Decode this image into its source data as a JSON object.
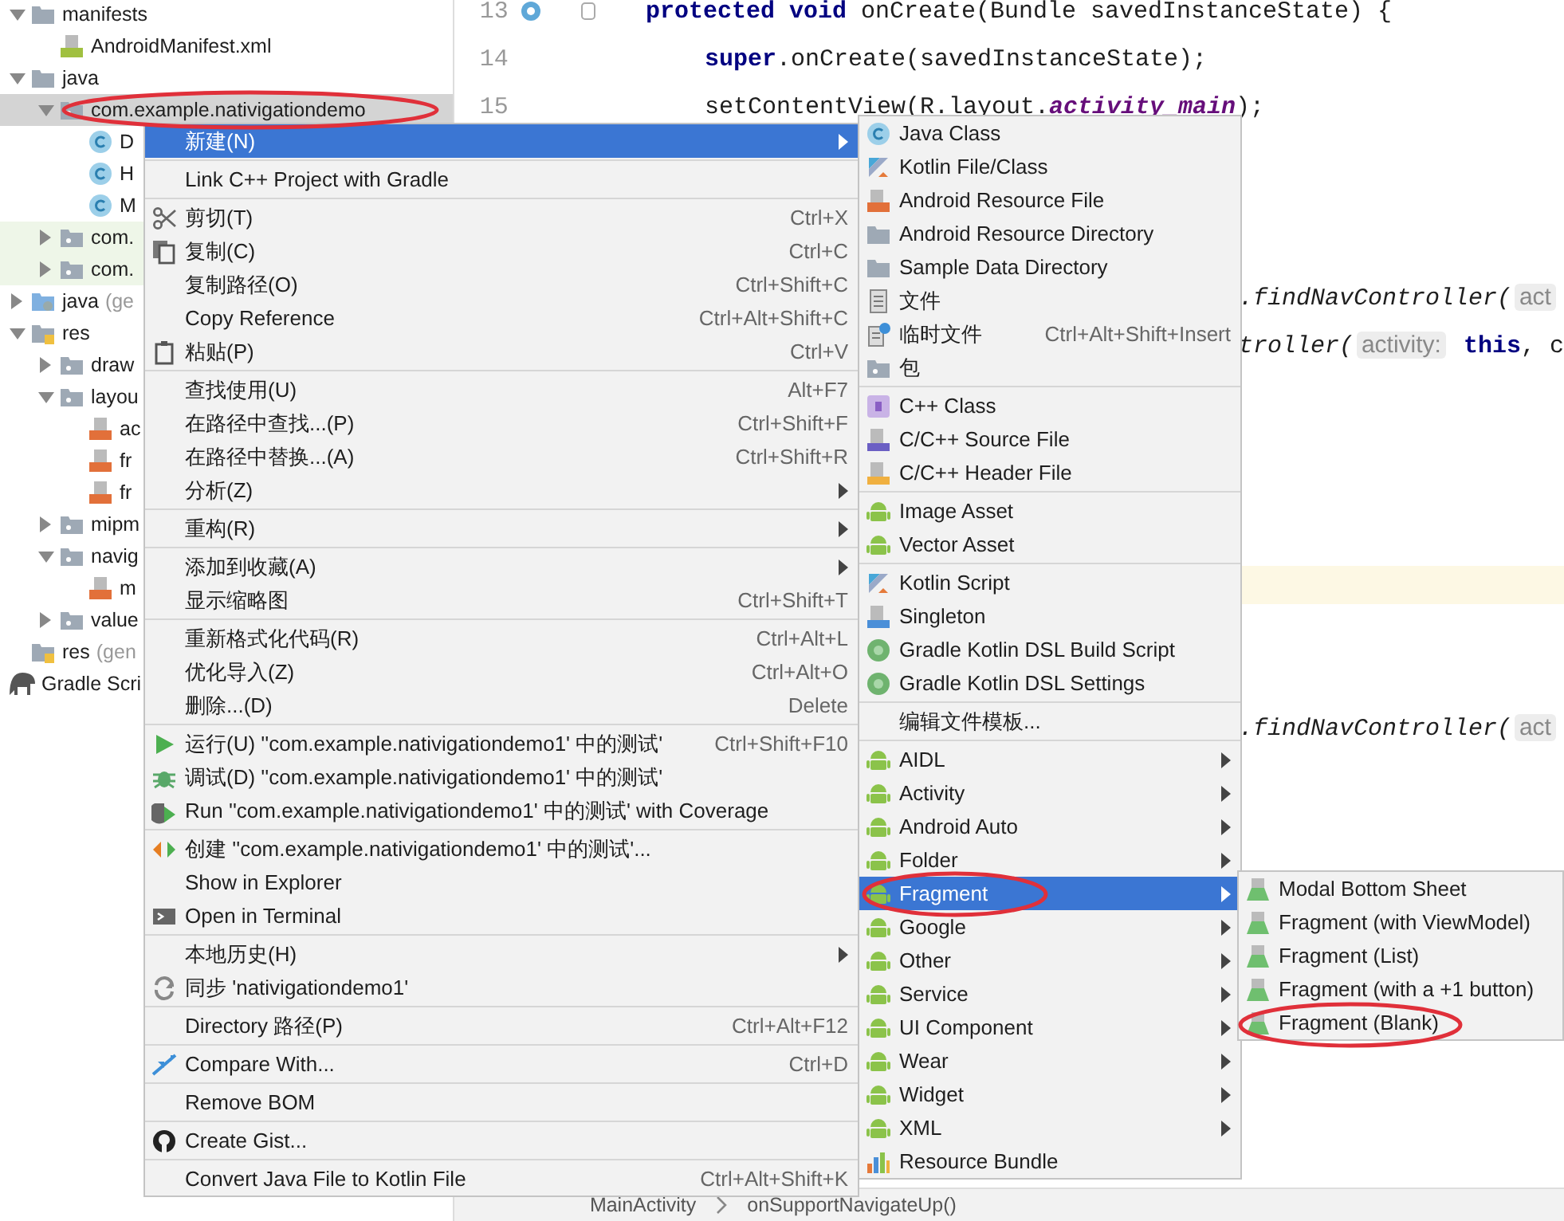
{
  "project_tree": {
    "items": [
      {
        "label": "manifests",
        "kind": "folder",
        "expanded": true,
        "selected": false,
        "children": [
          {
            "label": "AndroidManifest.xml",
            "kind": "manifest-file",
            "selected": false
          }
        ]
      },
      {
        "label": "java",
        "kind": "folder",
        "expanded": true,
        "selected": false,
        "children": [
          {
            "label": "com.example.nativigationdemo",
            "kind": "package",
            "expanded": true,
            "selected": true,
            "children": [
              {
                "label": "D",
                "kind": "class",
                "selected": false
              },
              {
                "label": "H",
                "kind": "class",
                "selected": false
              },
              {
                "label": "M",
                "kind": "class",
                "selected": false
              }
            ]
          },
          {
            "label": "com.",
            "kind": "test-package",
            "expanded": false,
            "selected": false
          },
          {
            "label": "com.",
            "kind": "test-package",
            "expanded": false,
            "selected": false
          }
        ]
      },
      {
        "label": "java",
        "note": "(ge",
        "kind": "generated-folder",
        "expanded": false,
        "selected": false
      },
      {
        "label": "res",
        "kind": "res-folder",
        "expanded": true,
        "selected": false,
        "children": [
          {
            "label": "draw",
            "kind": "package",
            "expanded": false,
            "selected": false
          },
          {
            "label": "layou",
            "kind": "package",
            "expanded": true,
            "selected": false,
            "children": [
              {
                "label": "ac",
                "kind": "layout-file",
                "selected": false
              },
              {
                "label": "fr",
                "kind": "layout-file",
                "selected": false
              },
              {
                "label": "fr",
                "kind": "layout-file",
                "selected": false
              }
            ]
          },
          {
            "label": "mipm",
            "kind": "package",
            "expanded": false,
            "selected": false
          },
          {
            "label": "navig",
            "kind": "package",
            "expanded": true,
            "selected": false,
            "children": [
              {
                "label": "m",
                "kind": "layout-file",
                "selected": false
              }
            ]
          },
          {
            "label": "value",
            "kind": "package",
            "expanded": false,
            "selected": false
          }
        ]
      },
      {
        "label": "res",
        "note": "(gen",
        "kind": "res-folder",
        "selected": false
      },
      {
        "label": "Gradle Scri",
        "kind": "gradle",
        "selected": false
      }
    ]
  },
  "editor": {
    "lines": [
      {
        "number": "13",
        "segments": [
          {
            "text": "protected void ",
            "kind": "keyword"
          },
          {
            "text": "onCreate(Bundle savedInstanceState) {",
            "kind": "plain"
          }
        ]
      },
      {
        "number": "14",
        "segments": [
          {
            "text": "super",
            "kind": "keyword"
          },
          {
            "text": ".onCreate(savedInstanceState);",
            "kind": "plain"
          }
        ]
      },
      {
        "number": "15",
        "segments": [
          {
            "text": "setContentView(R.layout.",
            "kind": "plain"
          },
          {
            "text": "activity_main",
            "kind": "field"
          },
          {
            "text": ");",
            "kind": "plain"
          }
        ]
      }
    ],
    "fragments": [
      {
        "segments": [
          {
            "text": ".findNavController(",
            "kind": "method"
          },
          {
            "text": "act",
            "kind": "hint"
          }
        ]
      },
      {
        "segments": [
          {
            "text": "troller(",
            "kind": "method"
          },
          {
            "text": "activity:",
            "kind": "hint"
          },
          {
            "text": " this",
            "kind": "keyword"
          },
          {
            "text": ", c",
            "kind": "plain"
          }
        ]
      },
      {
        "segments": [
          {
            "text": ".findNavController(",
            "kind": "method"
          },
          {
            "text": "act",
            "kind": "hint"
          }
        ]
      }
    ]
  },
  "breadcrumb": [
    "MainActivity",
    "onSupportNavigateUp()"
  ],
  "context_menu": {
    "groups": [
      {
        "items": [
          {
            "label": "新建(N)",
            "submenu": true,
            "selected": true
          }
        ]
      },
      {
        "items": [
          {
            "label": "Link C++ Project with Gradle",
            "submenu": false,
            "selected": false
          }
        ]
      },
      {
        "items": [
          {
            "label": "剪切(T)",
            "shortcut": "Ctrl+X",
            "submenu": false,
            "selected": false
          },
          {
            "label": "复制(C)",
            "shortcut": "Ctrl+C",
            "submenu": false,
            "selected": false
          },
          {
            "label": "复制路径(O)",
            "shortcut": "Ctrl+Shift+C",
            "submenu": false,
            "selected": false
          },
          {
            "label": "Copy Reference",
            "shortcut": "Ctrl+Alt+Shift+C",
            "submenu": false,
            "selected": false
          },
          {
            "label": "粘贴(P)",
            "shortcut": "Ctrl+V",
            "submenu": false,
            "selected": false
          }
        ]
      },
      {
        "items": [
          {
            "label": "查找使用(U)",
            "shortcut": "Alt+F7",
            "submenu": false,
            "selected": false
          },
          {
            "label": "在路径中查找...(P)",
            "shortcut": "Ctrl+Shift+F",
            "submenu": false,
            "selected": false
          },
          {
            "label": "在路径中替换...(A)",
            "shortcut": "Ctrl+Shift+R",
            "submenu": false,
            "selected": false
          },
          {
            "label": "分析(Z)",
            "submenu": true,
            "selected": false
          }
        ]
      },
      {
        "items": [
          {
            "label": "重构(R)",
            "submenu": true,
            "selected": false
          }
        ]
      },
      {
        "items": [
          {
            "label": "添加到收藏(A)",
            "submenu": true,
            "selected": false
          },
          {
            "label": "显示缩略图",
            "shortcut": "Ctrl+Shift+T",
            "submenu": false,
            "selected": false
          }
        ]
      },
      {
        "items": [
          {
            "label": "重新格式化代码(R)",
            "shortcut": "Ctrl+Alt+L",
            "submenu": false,
            "selected": false
          },
          {
            "label": "优化导入(Z)",
            "shortcut": "Ctrl+Alt+O",
            "submenu": false,
            "selected": false
          },
          {
            "label": "删除...(D)",
            "shortcut": "Delete",
            "submenu": false,
            "selected": false
          }
        ]
      },
      {
        "items": [
          {
            "label": "运行(U) ''com.example.nativigationdemo1' 中的测试'",
            "shortcut": "Ctrl+Shift+F10",
            "submenu": false,
            "selected": false
          },
          {
            "label": "调试(D) ''com.example.nativigationdemo1' 中的测试'",
            "submenu": false,
            "selected": false
          },
          {
            "label": "Run ''com.example.nativigationdemo1' 中的测试' with Coverage",
            "submenu": false,
            "selected": false
          }
        ]
      },
      {
        "items": [
          {
            "label": "创建 ''com.example.nativigationdemo1' 中的测试'...",
            "submenu": false,
            "selected": false
          },
          {
            "label": "Show in Explorer",
            "submenu": false,
            "selected": false
          },
          {
            "label": "Open in Terminal",
            "submenu": false,
            "selected": false
          }
        ]
      },
      {
        "items": [
          {
            "label": "本地历史(H)",
            "submenu": true,
            "selected": false
          },
          {
            "label": "同步 'nativigationdemo1'",
            "submenu": false,
            "selected": false
          }
        ]
      },
      {
        "items": [
          {
            "label": "Directory 路径(P)",
            "shortcut": "Ctrl+Alt+F12",
            "submenu": false,
            "selected": false
          }
        ]
      },
      {
        "items": [
          {
            "label": "Compare With...",
            "shortcut": "Ctrl+D",
            "submenu": false,
            "selected": false
          }
        ]
      },
      {
        "items": [
          {
            "label": "Remove BOM",
            "submenu": false,
            "selected": false
          }
        ]
      },
      {
        "items": [
          {
            "label": "Create Gist...",
            "submenu": false,
            "selected": false
          }
        ]
      },
      {
        "items": [
          {
            "label": "Convert Java File to Kotlin File",
            "shortcut": "Ctrl+Alt+Shift+K",
            "submenu": false,
            "selected": false
          }
        ]
      }
    ]
  },
  "new_submenu": {
    "groups": [
      {
        "items": [
          {
            "label": "Java Class",
            "submenu": false,
            "selected": false
          },
          {
            "label": "Kotlin File/Class",
            "submenu": false,
            "selected": false
          },
          {
            "label": "Android Resource File",
            "submenu": false,
            "selected": false
          },
          {
            "label": "Android Resource Directory",
            "submenu": false,
            "selected": false
          },
          {
            "label": "Sample Data Directory",
            "submenu": false,
            "selected": false
          },
          {
            "label": "文件",
            "submenu": false,
            "selected": false
          },
          {
            "label": "临时文件",
            "shortcut": "Ctrl+Alt+Shift+Insert",
            "submenu": false,
            "selected": false
          },
          {
            "label": "包",
            "submenu": false,
            "selected": false
          }
        ]
      },
      {
        "items": [
          {
            "label": "C++ Class",
            "submenu": false,
            "selected": false
          },
          {
            "label": "C/C++ Source File",
            "submenu": false,
            "selected": false
          },
          {
            "label": "C/C++ Header File",
            "submenu": false,
            "selected": false
          }
        ]
      },
      {
        "items": [
          {
            "label": "Image Asset",
            "submenu": false,
            "selected": false
          },
          {
            "label": "Vector Asset",
            "submenu": false,
            "selected": false
          }
        ]
      },
      {
        "items": [
          {
            "label": "Kotlin Script",
            "submenu": false,
            "selected": false
          },
          {
            "label": "Singleton",
            "submenu": false,
            "selected": false
          },
          {
            "label": "Gradle Kotlin DSL Build Script",
            "submenu": false,
            "selected": false
          },
          {
            "label": "Gradle Kotlin DSL Settings",
            "submenu": false,
            "selected": false
          }
        ]
      },
      {
        "items": [
          {
            "label": "编辑文件模板...",
            "submenu": false,
            "selected": false
          }
        ]
      },
      {
        "items": [
          {
            "label": "AIDL",
            "submenu": true,
            "selected": false
          },
          {
            "label": "Activity",
            "submenu": true,
            "selected": false
          },
          {
            "label": "Android Auto",
            "submenu": true,
            "selected": false
          },
          {
            "label": "Folder",
            "submenu": true,
            "selected": false
          },
          {
            "label": "Fragment",
            "submenu": true,
            "selected": true
          },
          {
            "label": "Google",
            "submenu": true,
            "selected": false
          },
          {
            "label": "Other",
            "submenu": true,
            "selected": false
          },
          {
            "label": "Service",
            "submenu": true,
            "selected": false
          },
          {
            "label": "UI Component",
            "submenu": true,
            "selected": false
          },
          {
            "label": "Wear",
            "submenu": true,
            "selected": false
          },
          {
            "label": "Widget",
            "submenu": true,
            "selected": false
          },
          {
            "label": "XML",
            "submenu": true,
            "selected": false
          },
          {
            "label": "Resource Bundle",
            "submenu": false,
            "selected": false
          }
        ]
      }
    ]
  },
  "fragment_submenu": {
    "groups": [
      {
        "items": [
          {
            "label": "Modal Bottom Sheet",
            "submenu": false,
            "selected": false
          },
          {
            "label": "Fragment (with ViewModel)",
            "submenu": false,
            "selected": false
          },
          {
            "label": "Fragment (List)",
            "submenu": false,
            "selected": false
          },
          {
            "label": "Fragment (with a +1 button)",
            "submenu": false,
            "selected": false
          },
          {
            "label": "Fragment (Blank)",
            "submenu": false,
            "selected": false
          }
        ]
      }
    ]
  }
}
